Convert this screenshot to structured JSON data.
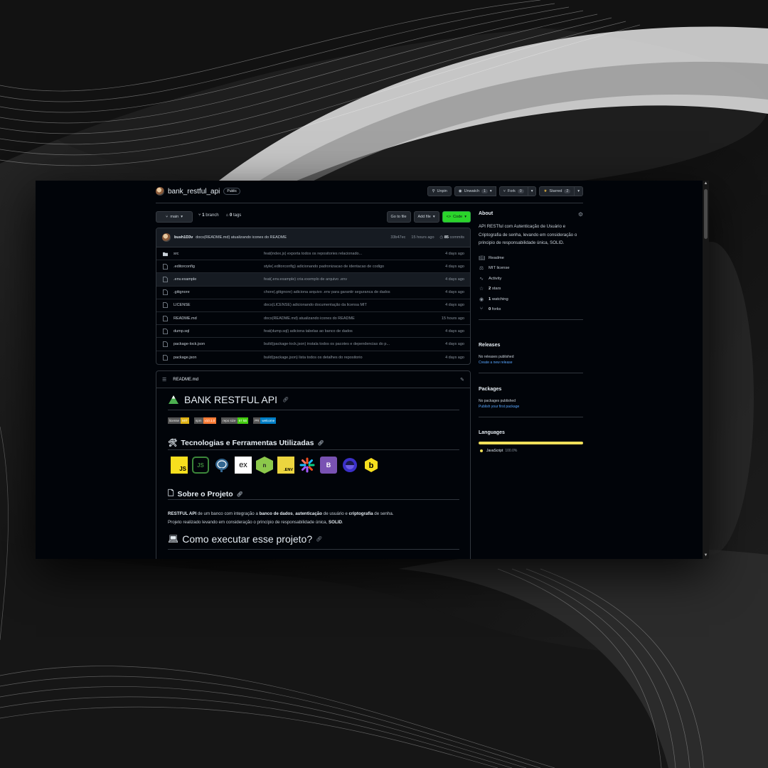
{
  "repo": {
    "name": "bank_restful_api",
    "visibility": "Public"
  },
  "header_actions": {
    "unpin": "Unpin",
    "unwatch": "Unwatch",
    "unwatch_count": "1",
    "fork": "Fork",
    "fork_count": "0",
    "starred": "Starred",
    "starred_count": "2"
  },
  "toolbar": {
    "branch": "main",
    "branches_count": "1",
    "branches_label": "branch",
    "tags_count": "0",
    "tags_label": "tags",
    "go_to_file": "Go to file",
    "add_file": "Add file",
    "code": "Code"
  },
  "latest_commit": {
    "author": "bush1D3v",
    "message": "docs(README.md) atualizando icones do README",
    "hash": "33b47ec",
    "time": "15 hours ago",
    "commits_count": "85",
    "commits_label": "commits"
  },
  "files": [
    {
      "name": "src",
      "type": "folder",
      "message": "feat(index.js) exporta todos os repositories relacionado...",
      "date": "4 days ago"
    },
    {
      "name": ".editorconfig",
      "type": "file",
      "message": "style(.editorconfig) adicionando padronizacao de identacao de codigo",
      "date": "4 days ago"
    },
    {
      "name": ".env.example",
      "type": "file",
      "message": "feat(.env.example) cria exemplo de arquivo .env",
      "date": "4 days ago"
    },
    {
      "name": ".gitignore",
      "type": "file",
      "message": "chore(.gitignore) adiciona arquivo .env para garantir seguranca de dados",
      "date": "4 days ago"
    },
    {
      "name": "LICENSE",
      "type": "file",
      "message": "docs(LICENSE) adicionando documentação da licensa MIT",
      "date": "4 days ago"
    },
    {
      "name": "README.md",
      "type": "file",
      "message": "docs(README.md) atualizando icones do README",
      "date": "15 hours ago"
    },
    {
      "name": "dump.sql",
      "type": "file",
      "message": "feat(dump.sql) adiciona tabelas ao banco de dados",
      "date": "4 days ago"
    },
    {
      "name": "package-lock.json",
      "type": "file",
      "message": "build(package-lock.json) instala todos os pacotes e dependencias do p...",
      "date": "4 days ago"
    },
    {
      "name": "package.json",
      "type": "file",
      "message": "build(package.json) lista todos os detalhes do repositorio",
      "date": "4 days ago"
    }
  ],
  "readme": {
    "filename": "README.md",
    "title": "BANK RESTFUL API",
    "shields": [
      {
        "label": "license",
        "value": "MIT",
        "color": "#dfb317"
      },
      {
        "label": "npm",
        "value": "v10.1.0",
        "color": "#fe7d37"
      },
      {
        "label": "repo size",
        "value": "67 kB",
        "color": "#4c1"
      },
      {
        "label": "PR",
        "value": "welcome",
        "color": "#007ec6"
      }
    ],
    "tech_heading": "Tecnologias e Ferramentas Utilizadas",
    "tech_icons": [
      "JS",
      "JS",
      "postgresql-icon",
      "ex",
      "n",
      ".ENV",
      "jest-icon",
      "B",
      "o",
      "b"
    ],
    "about_heading": "Sobre o Projeto",
    "about_p1_b1": "RESTFUL API",
    "about_p1_t1": " de um banco com integração a ",
    "about_p1_b2": "banco de dados",
    "about_p1_t2": ", ",
    "about_p1_b3": "autenticação",
    "about_p1_t3": " de usuário e ",
    "about_p1_b4": "criptografia",
    "about_p1_t4": " de senha.",
    "about_p2_t1": "Projeto realizado levando em consideração o princípio de responsabilidade única, ",
    "about_p2_b1": "SOLID",
    "about_p2_t2": ".",
    "run_heading": "Como executar esse projeto?"
  },
  "sidebar": {
    "about_title": "About",
    "description": "API RESTful com Autenticação de Usuário e Criptografia de senha, levando em consideração o principio de responsabilidade única, SOLID.",
    "links": [
      {
        "icon": "book-icon",
        "text": "Readme",
        "bold": ""
      },
      {
        "icon": "scale-icon",
        "text": "MIT license",
        "bold": ""
      },
      {
        "icon": "pulse-icon",
        "text": "Activity",
        "bold": ""
      },
      {
        "icon": "star-icon",
        "bold": "2",
        "text": " stars"
      },
      {
        "icon": "eye-icon",
        "bold": "1",
        "text": " watching"
      },
      {
        "icon": "fork-icon",
        "bold": "0",
        "text": " forks"
      }
    ],
    "releases_title": "Releases",
    "releases_none": "No releases published",
    "releases_link": "Create a new release",
    "packages_title": "Packages",
    "packages_none": "No packages published",
    "packages_link": "Publish your first package",
    "languages_title": "Languages",
    "language_name": "JavaScript",
    "language_pct": "100.0%",
    "language_color": "#f1e05a"
  }
}
